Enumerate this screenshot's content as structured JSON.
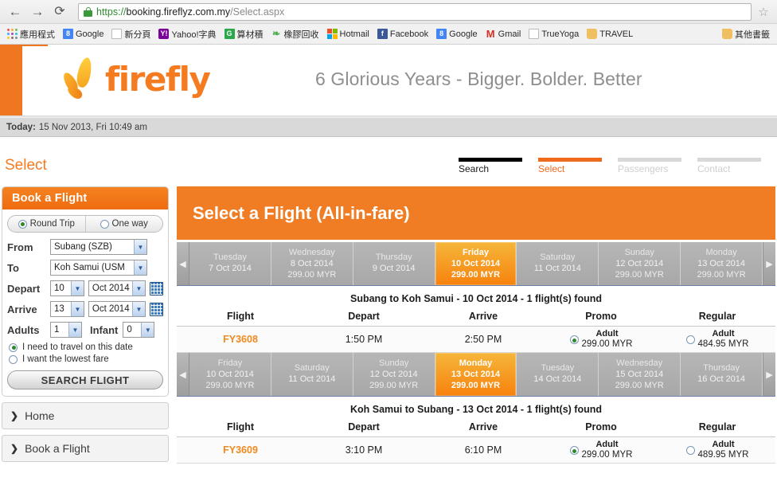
{
  "browser": {
    "back_icon": "←",
    "forward_icon": "→",
    "reload_icon": "⟳",
    "url_scheme": "https://",
    "url_host": "booking.fireflyz.com.my",
    "url_path": "/Select.aspx",
    "star_icon": "☆",
    "bookmarks": [
      {
        "label": "應用程式",
        "icon": "apps-grid-icon"
      },
      {
        "label": "Google",
        "icon": "google-icon"
      },
      {
        "label": "新分頁",
        "icon": "page-icon"
      },
      {
        "label": "Yahoo!字典",
        "icon": "yahoo-icon"
      },
      {
        "label": "算材積",
        "icon": "green-g-icon"
      },
      {
        "label": "橡膠回收",
        "icon": "leaf-icon"
      },
      {
        "label": "Hotmail",
        "icon": "microsoft-icon"
      },
      {
        "label": "Facebook",
        "icon": "facebook-icon"
      },
      {
        "label": "Google",
        "icon": "google-icon"
      },
      {
        "label": "Gmail",
        "icon": "gmail-icon"
      },
      {
        "label": "TrueYoga",
        "icon": "page-icon"
      },
      {
        "label": "TRAVEL",
        "icon": "folder-icon"
      }
    ],
    "bookmarks_overflow": {
      "label": "其他書籤",
      "icon": "folder-icon"
    }
  },
  "site": {
    "logo_text": "firefly",
    "tagline": "6 Glorious Years - Bigger. Bolder. Better",
    "today_label": "Today:",
    "today_value": "15 Nov 2013, Fri 10:49 am",
    "brand_orange": "#f07d24"
  },
  "page": {
    "title": "Select",
    "steps": [
      {
        "label": "Search",
        "state": "done"
      },
      {
        "label": "Select",
        "state": "active"
      },
      {
        "label": "Passengers",
        "state": "todo"
      },
      {
        "label": "Contact",
        "state": "todo"
      }
    ]
  },
  "sidebar": {
    "panel_title": "Book a Flight",
    "trip_type": {
      "round_trip": "Round Trip",
      "one_way": "One way",
      "selected": "Round Trip"
    },
    "fields": {
      "from_label": "From",
      "from_value": "Subang (SZB)",
      "to_label": "To",
      "to_value": "Koh Samui (USM",
      "depart_label": "Depart",
      "depart_day": "10",
      "depart_month": "Oct 2014",
      "arrive_label": "Arrive",
      "arrive_day": "13",
      "arrive_month": "Oct 2014",
      "adults_label": "Adults",
      "adults_value": "1",
      "infant_label": "Infant",
      "infant_value": "0"
    },
    "fare_options": {
      "exact_date": "I need to travel on this date",
      "lowest_fare": "I want the lowest fare",
      "selected": "I need to travel on this date"
    },
    "search_button": "SEARCH FLIGHT",
    "nav_items": [
      {
        "label": "Home"
      },
      {
        "label": "Book a Flight"
      }
    ]
  },
  "main": {
    "heading": "Select a Flight (All-in-fare)",
    "prev_arrow": "◀",
    "next_arrow": "▶",
    "outbound": {
      "dates": [
        {
          "day": "Tuesday",
          "date": "7 Oct 2014",
          "fare": "",
          "selected": false
        },
        {
          "day": "Wednesday",
          "date": "8 Oct 2014",
          "fare": "299.00 MYR",
          "selected": false
        },
        {
          "day": "Thursday",
          "date": "9 Oct 2014",
          "fare": "",
          "selected": false
        },
        {
          "day": "Friday",
          "date": "10 Oct 2014",
          "fare": "299.00 MYR",
          "selected": true
        },
        {
          "day": "Saturday",
          "date": "11 Oct 2014",
          "fare": "",
          "selected": false
        },
        {
          "day": "Sunday",
          "date": "12 Oct 2014",
          "fare": "299.00 MYR",
          "selected": false
        },
        {
          "day": "Monday",
          "date": "13 Oct 2014",
          "fare": "299.00 MYR",
          "selected": false
        }
      ],
      "leg_title": "Subang to Koh Samui - 10 Oct 2014 - 1  flight(s) found",
      "columns": [
        "Flight",
        "Depart",
        "Arrive",
        "Promo",
        "Regular"
      ],
      "rows": [
        {
          "flight": "FY3608",
          "depart": "1:50 PM",
          "arrive": "2:50 PM",
          "promo_pax": "Adult",
          "promo_fare": "299.00 MYR",
          "promo_selected": true,
          "regular_pax": "Adult",
          "regular_fare": "484.95 MYR",
          "regular_selected": false
        }
      ]
    },
    "inbound": {
      "dates": [
        {
          "day": "Friday",
          "date": "10 Oct 2014",
          "fare": "299.00 MYR",
          "selected": false
        },
        {
          "day": "Saturday",
          "date": "11 Oct 2014",
          "fare": "",
          "selected": false
        },
        {
          "day": "Sunday",
          "date": "12 Oct 2014",
          "fare": "299.00 MYR",
          "selected": false
        },
        {
          "day": "Monday",
          "date": "13 Oct 2014",
          "fare": "299.00 MYR",
          "selected": true
        },
        {
          "day": "Tuesday",
          "date": "14 Oct 2014",
          "fare": "",
          "selected": false
        },
        {
          "day": "Wednesday",
          "date": "15 Oct 2014",
          "fare": "299.00 MYR",
          "selected": false
        },
        {
          "day": "Thursday",
          "date": "16 Oct 2014",
          "fare": "",
          "selected": false
        }
      ],
      "leg_title": "Koh Samui to Subang - 13 Oct 2014 - 1  flight(s) found",
      "columns": [
        "Flight",
        "Depart",
        "Arrive",
        "Promo",
        "Regular"
      ],
      "rows": [
        {
          "flight": "FY3609",
          "depart": "3:10 PM",
          "arrive": "6:10 PM",
          "promo_pax": "Adult",
          "promo_fare": "299.00 MYR",
          "promo_selected": true,
          "regular_pax": "Adult",
          "regular_fare": "489.95 MYR",
          "regular_selected": false
        }
      ]
    }
  }
}
